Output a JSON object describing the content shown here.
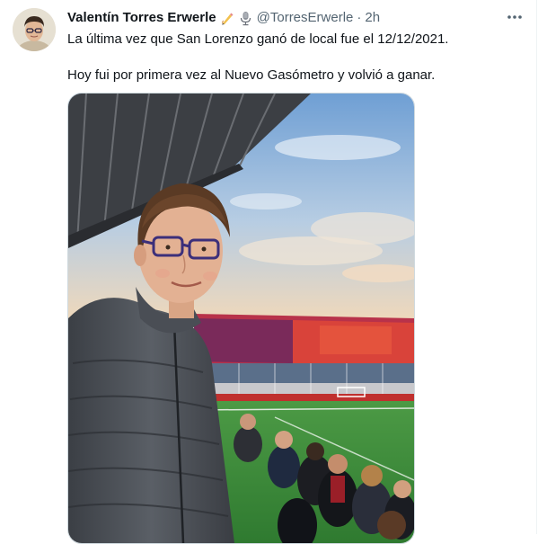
{
  "tweet": {
    "display_name": "Valentín Torres Erwerle",
    "name_emojis": [
      "writing-hand-icon",
      "microphone-icon"
    ],
    "handle": "@TorresErwerle",
    "separator": "·",
    "time": "2h",
    "text_lines": [
      "La última vez que San Lorenzo ganó de local fue el 12/12/2021.",
      "Hoy fui por primera vez al Nuevo Gasómetro y volvió a ganar."
    ],
    "more_icon": "more-horizontal-icon"
  },
  "colors": {
    "text_primary": "#0f1419",
    "text_secondary": "#536471",
    "border": "#cfd9de",
    "stadium_red": "#d94a3a",
    "stadium_blue": "#2a3a7a",
    "pitch_green": "#3f8a3a",
    "sky_blue": "#7fa9d6"
  }
}
